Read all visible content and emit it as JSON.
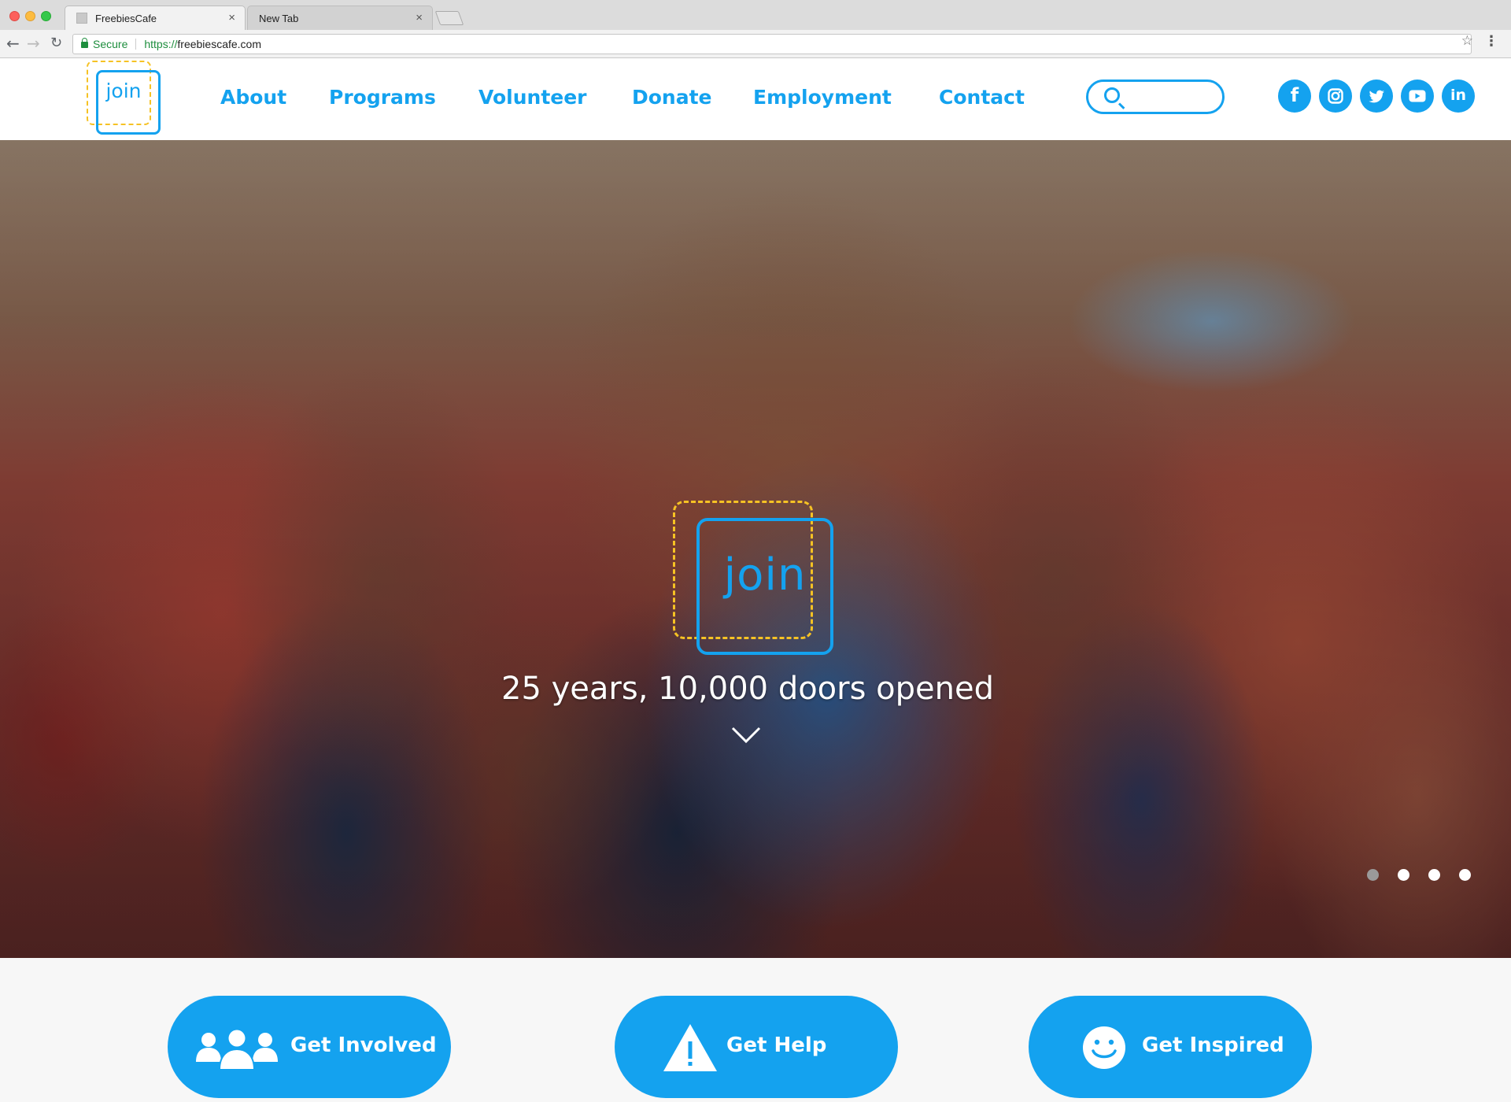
{
  "browser": {
    "tabs": [
      {
        "title": "FreebiesCafe",
        "active": true
      },
      {
        "title": "New Tab",
        "active": false
      }
    ],
    "tab_close_glyph": "×",
    "secure_label": "Secure",
    "url_protocol": "https://",
    "url_host": "freebiescafe.com"
  },
  "site": {
    "logo_text": "join",
    "nav": [
      "About",
      "Programs",
      "Volunteer",
      "Donate",
      "Employment",
      "Contact"
    ],
    "search": {
      "value": "",
      "placeholder": ""
    },
    "social": [
      {
        "name": "facebook-icon",
        "glyph": "f"
      },
      {
        "name": "instagram-icon",
        "glyph": ""
      },
      {
        "name": "twitter-icon",
        "glyph": ""
      },
      {
        "name": "youtube-icon",
        "glyph": ""
      },
      {
        "name": "linkedin-icon",
        "glyph": "in"
      }
    ],
    "brand_color": "#14a2ef",
    "accent_color": "#f6c224"
  },
  "hero": {
    "logo_text": "join",
    "tagline": "25 years, 10,000 doors opened",
    "slides": {
      "count": 4,
      "active": 2
    }
  },
  "cta": [
    {
      "label": "Get Involved",
      "icon": "people-icon"
    },
    {
      "label": "Get Help",
      "icon": "warning-icon"
    },
    {
      "label": "Get Inspired",
      "icon": "smiley-icon"
    }
  ]
}
